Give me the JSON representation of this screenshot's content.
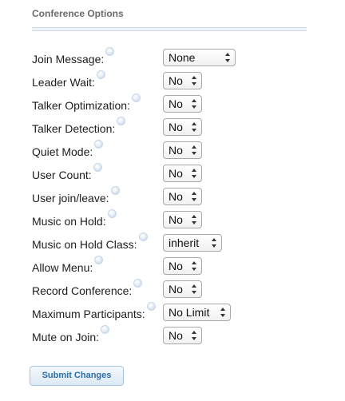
{
  "section": {
    "title": "Conference Options"
  },
  "options": [
    {
      "label": "Join Message:",
      "value": "None"
    },
    {
      "label": "Leader Wait:",
      "value": "No"
    },
    {
      "label": "Talker Optimization:",
      "value": "No"
    },
    {
      "label": "Talker Detection:",
      "value": "No"
    },
    {
      "label": "Quiet Mode:",
      "value": "No"
    },
    {
      "label": "User Count:",
      "value": "No"
    },
    {
      "label": "User join/leave:",
      "value": "No"
    },
    {
      "label": "Music on Hold:",
      "value": "No"
    },
    {
      "label": "Music on Hold Class:",
      "value": "inherit"
    },
    {
      "label": "Allow Menu:",
      "value": "No"
    },
    {
      "label": "Record Conference:",
      "value": "No"
    },
    {
      "label": "Maximum Participants:",
      "value": "No Limit"
    },
    {
      "label": "Mute on Join:",
      "value": "No"
    }
  ],
  "submit": {
    "label": "Submit Changes"
  },
  "icons": {
    "help": "info-bubble-icon",
    "select_arrows": "up-down-arrows-icon"
  },
  "colors": {
    "section_title": "#6a6a6a",
    "rule": "#c9d9ea",
    "button_text": "#2f6fa8",
    "button_border": "#a9c4dd"
  }
}
